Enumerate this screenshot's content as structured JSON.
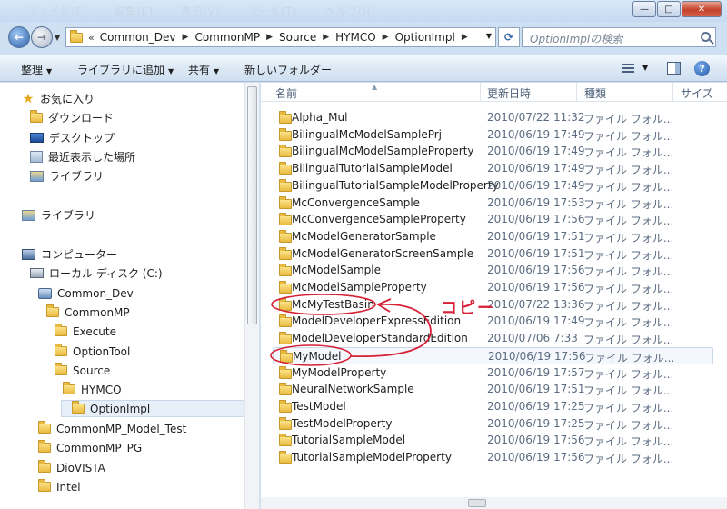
{
  "window": {
    "faded_menu": [
      "ファイル(F)",
      "編集(E)",
      "表示(V)",
      "ツール(T)",
      "ヘルプ(H)"
    ],
    "controls": {
      "minimize": "—",
      "maximize": "□",
      "close": "✕"
    }
  },
  "address": {
    "lead": "«",
    "crumbs": [
      "Common_Dev",
      "CommonMP",
      "Source",
      "HYMCO",
      "OptionImpl"
    ],
    "search_placeholder": "OptionImplの検索"
  },
  "toolbar": {
    "organize": "整理",
    "add_to_library": "ライブラリに追加",
    "share": "共有",
    "new_folder": "新しいフォルダー",
    "help": "?"
  },
  "nav": {
    "items": [
      {
        "label": "お気に入り",
        "icon": "star-icon"
      },
      {
        "label": "ダウンロード",
        "icon": "folder-icon"
      },
      {
        "label": "デスクトップ",
        "icon": "desktop-icon"
      },
      {
        "label": "最近表示した場所",
        "icon": "recent-icon"
      },
      {
        "label": "ライブラリ",
        "icon": "library-icon"
      },
      {
        "label": "ライブラリ",
        "icon": "library-icon"
      },
      {
        "label": "コンピューター",
        "icon": "computer-icon"
      },
      {
        "label": "ローカル ディスク (C:)",
        "icon": "drive-icon"
      },
      {
        "label": "Common_Dev",
        "icon": "network-drive-icon"
      },
      {
        "label": "CommonMP",
        "icon": "folder-icon"
      },
      {
        "label": "Execute",
        "icon": "folder-icon"
      },
      {
        "label": "OptionTool",
        "icon": "folder-icon"
      },
      {
        "label": "Source",
        "icon": "folder-icon"
      },
      {
        "label": "HYMCO",
        "icon": "folder-icon"
      },
      {
        "label": "OptionImpl",
        "icon": "folder-icon"
      },
      {
        "label": "CommonMP_Model_Test",
        "icon": "folder-icon"
      },
      {
        "label": "CommonMP_PG",
        "icon": "folder-icon"
      },
      {
        "label": "DioVISTA",
        "icon": "folder-icon"
      },
      {
        "label": "Intel",
        "icon": "folder-icon"
      }
    ],
    "selected": "OptionImpl"
  },
  "list": {
    "headers": {
      "name": "名前",
      "date": "更新日時",
      "type": "種類",
      "size": "サイズ"
    },
    "rows": [
      {
        "name": "Alpha_Mul",
        "date": "2010/07/22 11:32",
        "type": "ファイル フォル..."
      },
      {
        "name": "BilingualMcModelSamplePrj",
        "date": "2010/06/19 17:49",
        "type": "ファイル フォル..."
      },
      {
        "name": "BilingualMcModelSampleProperty",
        "date": "2010/06/19 17:49",
        "type": "ファイル フォル..."
      },
      {
        "name": "BilingualTutorialSampleModel",
        "date": "2010/06/19 17:49",
        "type": "ファイル フォル..."
      },
      {
        "name": "BilingualTutorialSampleModelProperty",
        "date": "2010/06/19 17:49",
        "type": "ファイル フォル..."
      },
      {
        "name": "McConvergenceSample",
        "date": "2010/06/19 17:53",
        "type": "ファイル フォル..."
      },
      {
        "name": "McConvergenceSampleProperty",
        "date": "2010/06/19 17:56",
        "type": "ファイル フォル..."
      },
      {
        "name": "McModelGeneratorSample",
        "date": "2010/06/19 17:51",
        "type": "ファイル フォル..."
      },
      {
        "name": "McModelGeneratorScreenSample",
        "date": "2010/06/19 17:51",
        "type": "ファイル フォル..."
      },
      {
        "name": "McModelSample",
        "date": "2010/06/19 17:56",
        "type": "ファイル フォル..."
      },
      {
        "name": "McModelSampleProperty",
        "date": "2010/06/19 17:56",
        "type": "ファイル フォル..."
      },
      {
        "name": "McMyTestBasin",
        "date": "2010/07/22 13:36",
        "type": "ファイル フォル..."
      },
      {
        "name": "ModelDeveloperExpressEdition",
        "date": "2010/06/19 17:49",
        "type": "ファイル フォル..."
      },
      {
        "name": "ModelDeveloperStandardEdition",
        "date": "2010/07/06 7:33",
        "type": "ファイル フォル..."
      },
      {
        "name": "MyModel",
        "date": "2010/06/19 17:56",
        "type": "ファイル フォル..."
      },
      {
        "name": "MyModelProperty",
        "date": "2010/06/19 17:57",
        "type": "ファイル フォル..."
      },
      {
        "name": "NeuralNetworkSample",
        "date": "2010/06/19 17:51",
        "type": "ファイル フォル..."
      },
      {
        "name": "TestModel",
        "date": "2010/06/19 17:25",
        "type": "ファイル フォル..."
      },
      {
        "name": "TestModelProperty",
        "date": "2010/06/19 17:25",
        "type": "ファイル フォル..."
      },
      {
        "name": "TutorialSampleModel",
        "date": "2010/06/19 17:56",
        "type": "ファイル フォル..."
      },
      {
        "name": "TutorialSampleModelProperty",
        "date": "2010/06/19 17:56",
        "type": "ファイル フォル..."
      }
    ],
    "hover_row": "MyModel"
  },
  "annotation": {
    "label": "コピー",
    "color": "#d71f35"
  }
}
